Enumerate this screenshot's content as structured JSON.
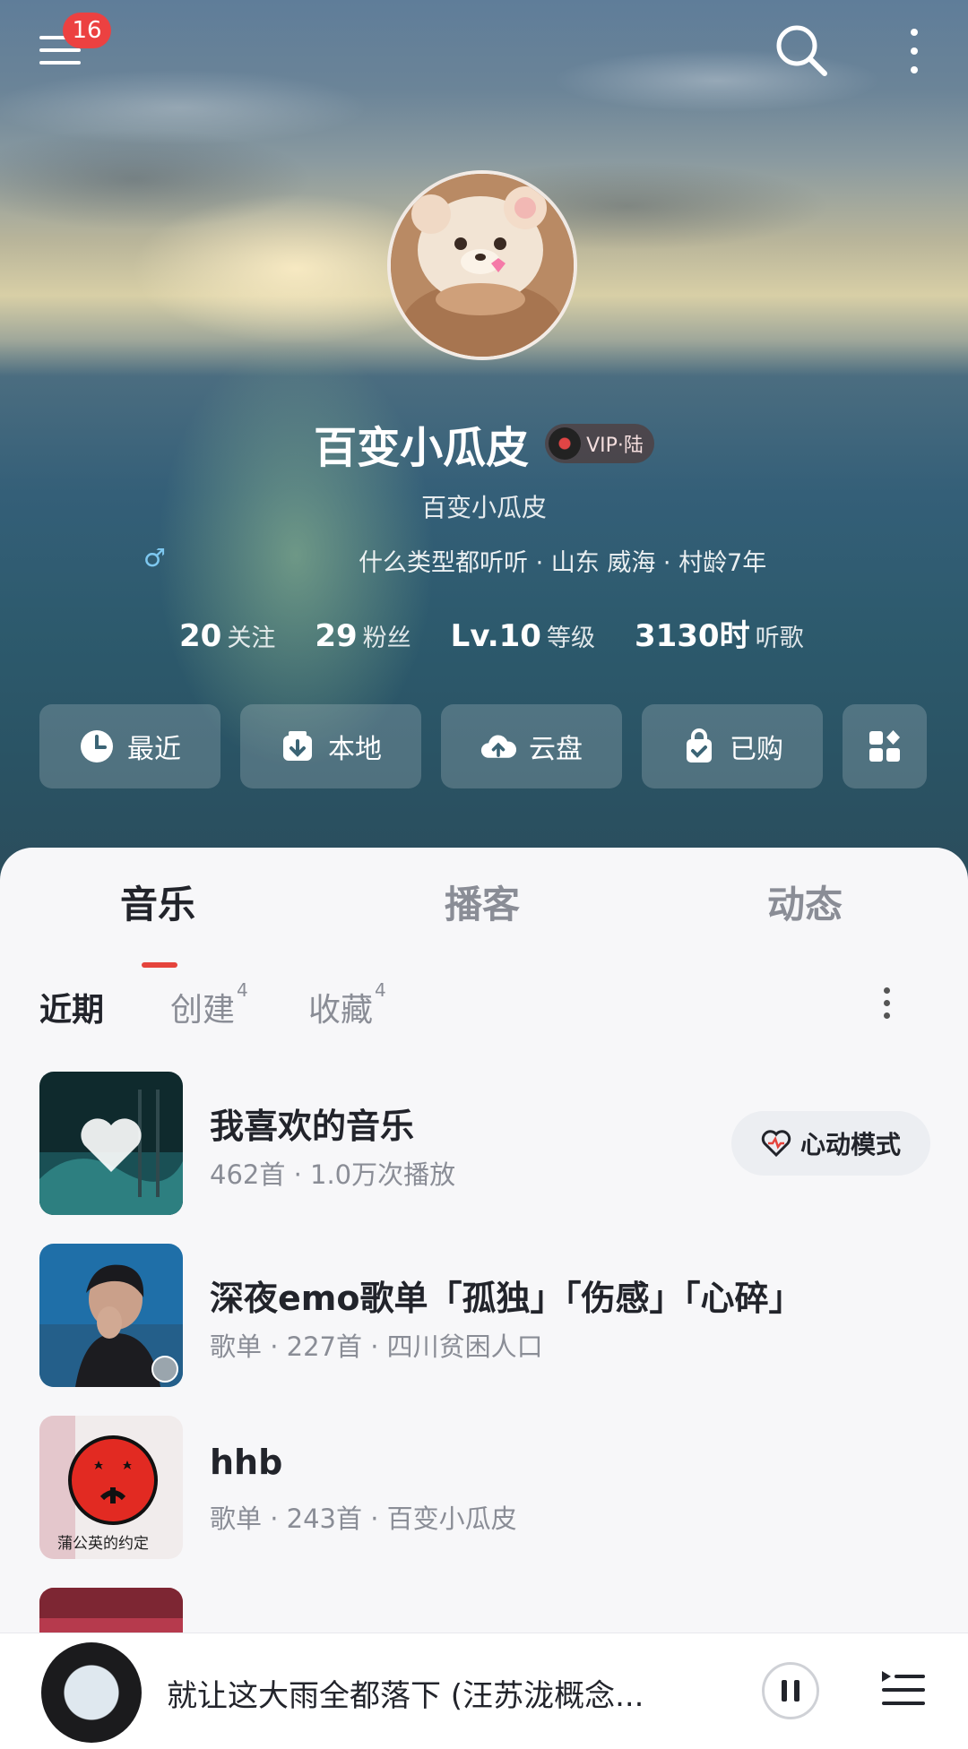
{
  "header": {
    "notification_count": "16"
  },
  "profile": {
    "nickname": "百变小瓜皮",
    "vip_label": "VIP·陆",
    "subname": "百变小瓜皮",
    "gender_symbol": "♂",
    "info": "什么类型都听听 · 山东 威海 · 村龄7年",
    "stats": [
      {
        "value": "20",
        "label": "关注"
      },
      {
        "value": "29",
        "label": "粉丝"
      },
      {
        "value": "Lv.10",
        "label": "等级"
      },
      {
        "value": "3130时",
        "label": "听歌"
      }
    ]
  },
  "quick_actions": [
    {
      "label": "最近",
      "icon": "clock-icon"
    },
    {
      "label": "本地",
      "icon": "download-icon"
    },
    {
      "label": "云盘",
      "icon": "cloud-upload-icon"
    },
    {
      "label": "已购",
      "icon": "shopping-bag-icon"
    },
    {
      "label": "",
      "icon": "apps-grid-icon"
    }
  ],
  "tabs": [
    "音乐",
    "播客",
    "动态"
  ],
  "subtabs": [
    {
      "label": "近期",
      "count": ""
    },
    {
      "label": "创建",
      "count": "4"
    },
    {
      "label": "收藏",
      "count": "4"
    }
  ],
  "playlists": [
    {
      "title": "我喜欢的音乐",
      "meta": "462首 · 1.0万次播放",
      "action": "心动模式"
    },
    {
      "title": "深夜emo歌单「孤独」「伤感」「心碎」",
      "meta": "歌单 · 227首 · 四川贫困人口"
    },
    {
      "title": "hhb",
      "meta": "歌单 · 243首 · 百变小瓜皮",
      "cover_text": "蒲公英的约定"
    }
  ],
  "player": {
    "title": "就让这大雨全都落下 (汪苏泷概念..."
  },
  "colors": {
    "accent": "#e5443c",
    "badge": "#ec4141",
    "text_primary": "#22242b",
    "text_secondary": "#8a8d96"
  }
}
